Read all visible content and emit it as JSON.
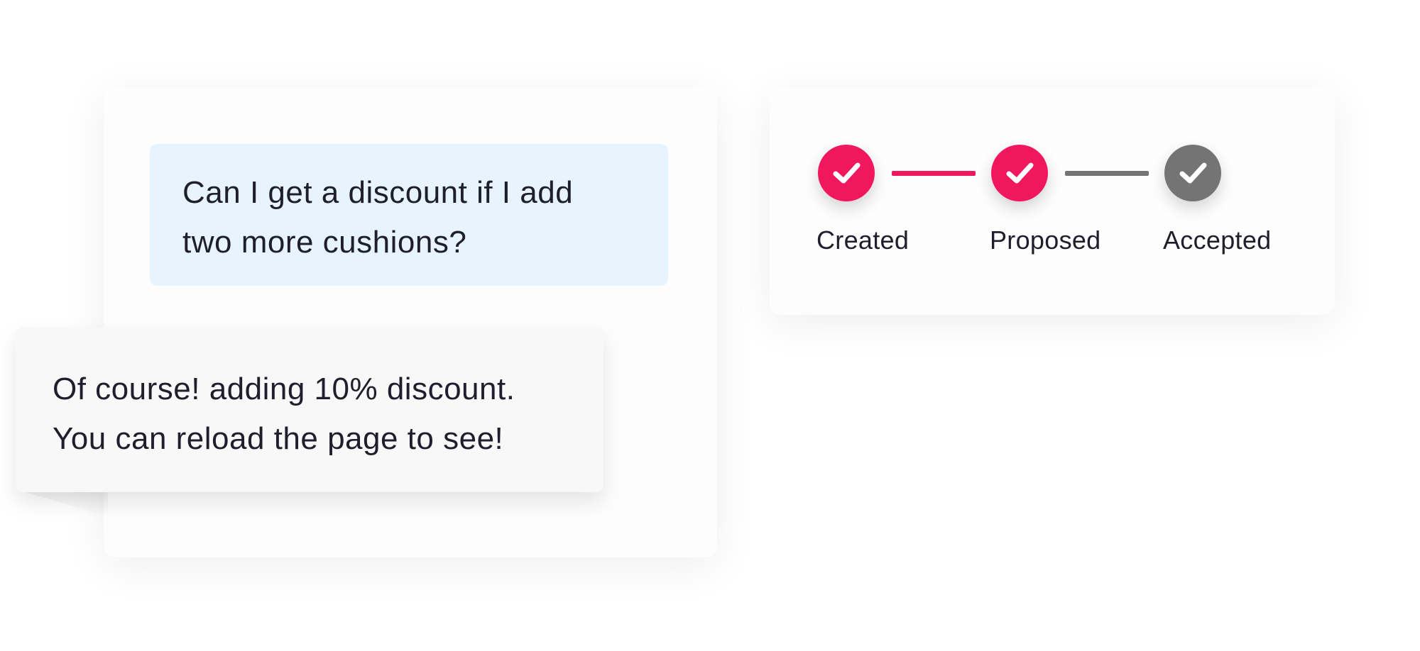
{
  "chat": {
    "user_message": {
      "lines": [
        "Can I get a discount if I add",
        "two more cushions?"
      ]
    },
    "reply_message": {
      "lines": [
        "Of course! adding 10% discount.",
        "You can reload the page to see!"
      ]
    }
  },
  "status": {
    "steps": [
      {
        "label": "Created",
        "state": "done",
        "color": "#f0175e",
        "icon": "check-icon"
      },
      {
        "label": "Proposed",
        "state": "done",
        "color": "#f0175e",
        "icon": "check-icon"
      },
      {
        "label": "Accepted",
        "state": "pending",
        "color": "#747474",
        "icon": "check-icon"
      }
    ],
    "connectors": [
      {
        "color": "#f0175e"
      },
      {
        "color": "#747474"
      }
    ]
  },
  "colors": {
    "accent": "#f0175e",
    "inactive": "#747474",
    "user_bubble_bg": "#e8f4fd",
    "reply_bubble_bg": "#f8f8f8",
    "text": "#1e1e2c"
  }
}
